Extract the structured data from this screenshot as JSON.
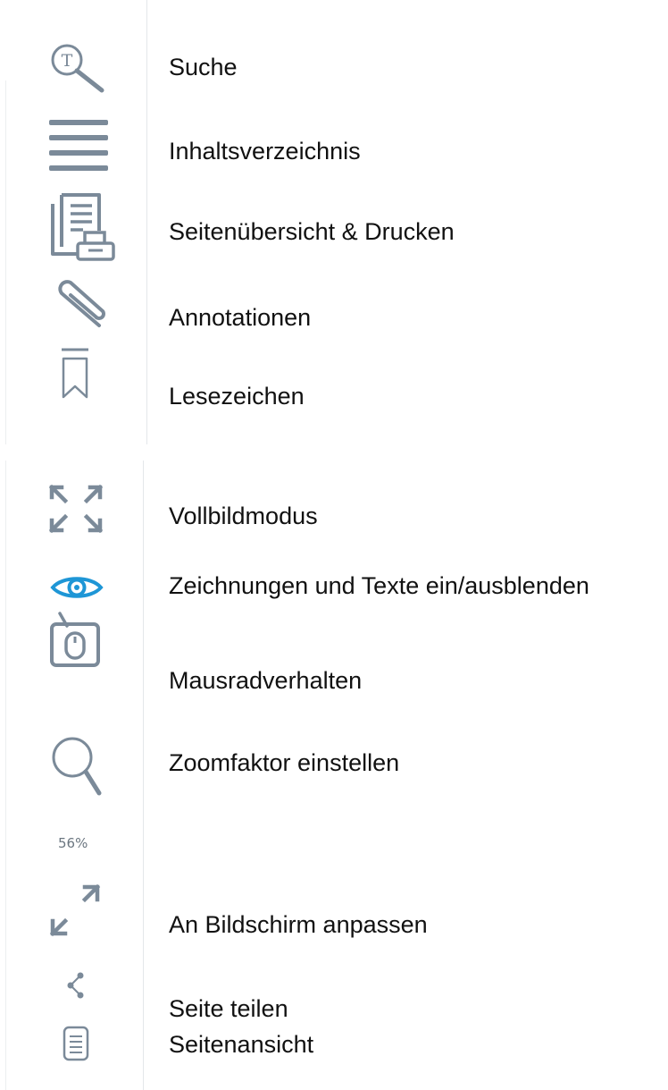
{
  "toolbar_top": {
    "items": [
      {
        "icon": "text-search-icon",
        "label": "Suche"
      },
      {
        "icon": "menu-icon",
        "label": "Inhaltsverzeichnis"
      },
      {
        "icon": "page-print-icon",
        "label": "Seitenübersicht & Drucken"
      },
      {
        "icon": "paperclip-icon",
        "label": "Annotationen"
      },
      {
        "icon": "bookmark-icon",
        "label": "Lesezeichen"
      }
    ]
  },
  "toolbar_bottom": {
    "items": [
      {
        "icon": "fullscreen-icon",
        "label": "Vollbildmodus"
      },
      {
        "icon": "eye-icon",
        "label": "Zeichnungen und Texte ein/ausblenden"
      },
      {
        "icon": "mouse-wheel-icon",
        "label": "Mausradverhalten"
      },
      {
        "icon": "zoom-icon",
        "label": "Zoomfaktor einstellen"
      },
      {
        "icon": "fit-screen-icon",
        "label": "An Bildschirm anpassen"
      },
      {
        "icon": "share-icon",
        "label": "Seite teilen"
      },
      {
        "icon": "page-view-icon",
        "label": "Seitenansicht"
      }
    ],
    "zoom_value": "56%"
  },
  "colors": {
    "icon": "#7b8a99",
    "accent": "#1e96d6",
    "text": "#111111",
    "divider": "#e4e7ea"
  }
}
